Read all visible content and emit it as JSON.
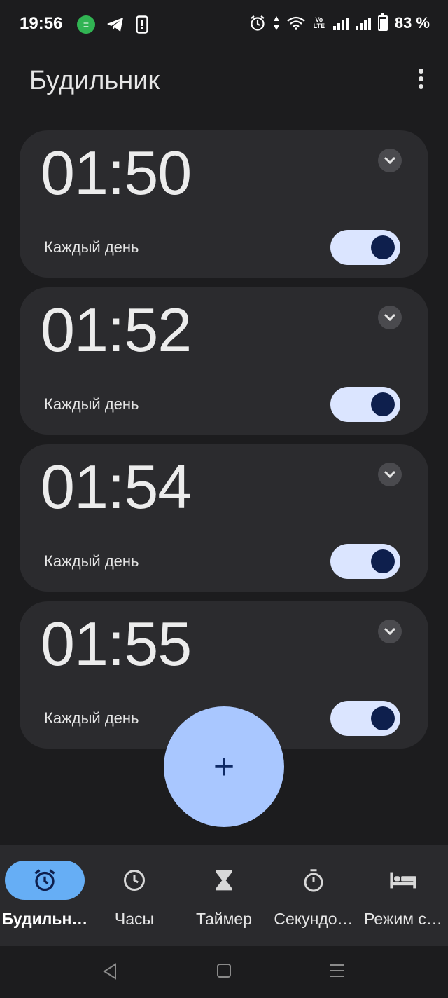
{
  "status_bar": {
    "time": "19:56",
    "battery_text": "83 %",
    "network_label": "Vo LTE",
    "icons": [
      "app-notification-icon",
      "telegram-icon",
      "phone-icon",
      "alarm-icon",
      "data-arrows-icon",
      "wifi-icon",
      "volte-icon",
      "signal-icon",
      "signal-icon",
      "battery-icon"
    ]
  },
  "header": {
    "title": "Будильник",
    "menu_icon": "more-vert-icon"
  },
  "alarms": [
    {
      "time": "01:50",
      "repeat": "Каждый день",
      "enabled": true
    },
    {
      "time": "01:52",
      "repeat": "Каждый день",
      "enabled": true
    },
    {
      "time": "01:54",
      "repeat": "Каждый день",
      "enabled": true
    },
    {
      "time": "01:55",
      "repeat": "Каждый день",
      "enabled": true
    }
  ],
  "fab": {
    "label": "+"
  },
  "bottom_nav": {
    "items": [
      {
        "label": "Будильн…",
        "icon": "alarm-icon",
        "active": true
      },
      {
        "label": "Часы",
        "icon": "clock-icon",
        "active": false
      },
      {
        "label": "Таймер",
        "icon": "hourglass-icon",
        "active": false
      },
      {
        "label": "Секундо…",
        "icon": "stopwatch-icon",
        "active": false
      },
      {
        "label": "Режим с…",
        "icon": "bed-icon",
        "active": false
      }
    ]
  },
  "system_nav": {
    "icons": [
      "back-icon",
      "home-icon",
      "recents-icon"
    ]
  },
  "colors": {
    "background": "#1c1c1e",
    "card": "#2b2b2e",
    "toggle_track": "#dbe5ff",
    "toggle_knob": "#0e1f4d",
    "fab": "#a9c7ff",
    "nav_active": "#66aef5"
  }
}
